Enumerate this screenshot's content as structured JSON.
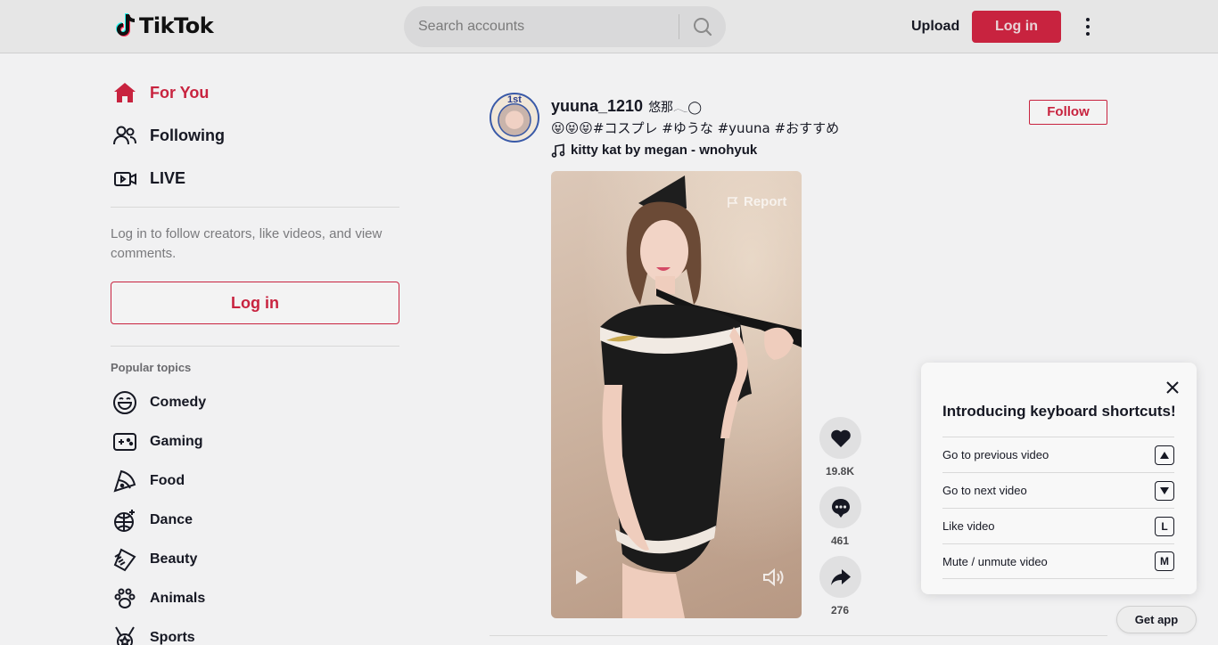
{
  "header": {
    "logo_text": "TikTok",
    "search_placeholder": "Search accounts",
    "upload_label": "Upload",
    "login_label": "Log in"
  },
  "sidebar": {
    "nav": [
      {
        "label": "For You",
        "icon": "home-icon",
        "active": true
      },
      {
        "label": "Following",
        "icon": "people-icon",
        "active": false
      },
      {
        "label": "LIVE",
        "icon": "live-icon",
        "active": false
      }
    ],
    "login_prompt": "Log in to follow creators, like videos, and view comments.",
    "login_button": "Log in",
    "topics_title": "Popular topics",
    "topics": [
      {
        "label": "Comedy",
        "icon": "smile-icon"
      },
      {
        "label": "Gaming",
        "icon": "gamepad-icon"
      },
      {
        "label": "Food",
        "icon": "pizza-icon"
      },
      {
        "label": "Dance",
        "icon": "disco-ball-icon"
      },
      {
        "label": "Beauty",
        "icon": "comb-icon"
      },
      {
        "label": "Animals",
        "icon": "paw-icon"
      },
      {
        "label": "Sports",
        "icon": "medal-icon"
      }
    ]
  },
  "post": {
    "avatar_badge": "1st",
    "username": "yuuna_1210",
    "nickname": "悠那𓂃◯",
    "caption": "😝😝😝#コスプレ #ゆうな #yuuna #おすすめ",
    "music": "kitty kat by megan - wnohyuk",
    "follow_label": "Follow",
    "report_label": "Report",
    "likes": "19.8K",
    "comments": "461",
    "shares": "276"
  },
  "shortcuts": {
    "title": "Introducing keyboard shortcuts!",
    "items": [
      {
        "label": "Go to previous video",
        "key": "▲"
      },
      {
        "label": "Go to next video",
        "key": "▼"
      },
      {
        "label": "Like video",
        "key": "L"
      },
      {
        "label": "Mute / unmute video",
        "key": "M"
      }
    ]
  },
  "get_app_label": "Get app",
  "colors": {
    "brand": "#c8233f",
    "background": "#f1f1f2",
    "text": "#161823"
  }
}
